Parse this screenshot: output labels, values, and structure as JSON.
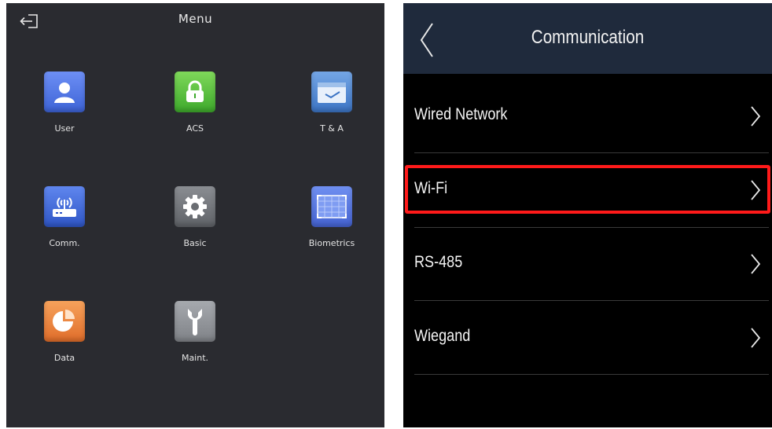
{
  "left_panel": {
    "title": "Menu",
    "back_icon": "logout-arrow-icon",
    "tiles": [
      {
        "label": "User",
        "icon": "user-icon",
        "color": "#4a6fe0"
      },
      {
        "label": "ACS",
        "icon": "lock-icon",
        "color": "#4cb83a"
      },
      {
        "label": "T & A",
        "icon": "time-attendance-icon",
        "color": "#4a82cf"
      },
      {
        "label": "Comm.",
        "icon": "router-icon",
        "color": "#3a62d4"
      },
      {
        "label": "Basic",
        "icon": "gear-icon",
        "color": "#6d7075"
      },
      {
        "label": "Biometrics",
        "icon": "biometrics-grid-icon",
        "color": "#5070de"
      },
      {
        "label": "Data",
        "icon": "pie-chart-icon",
        "color": "#ea7f3a"
      },
      {
        "label": "Maint.",
        "icon": "wrench-icon",
        "color": "#8d9095"
      }
    ]
  },
  "right_panel": {
    "title": "Communication",
    "back_icon": "chevron-left-icon",
    "items": [
      {
        "label": "Wired Network",
        "icon": "chevron-right-icon"
      },
      {
        "label": "Wi-Fi",
        "icon": "chevron-right-icon",
        "highlighted": true
      },
      {
        "label": "RS-485",
        "icon": "chevron-right-icon"
      },
      {
        "label": "Wiegand",
        "icon": "chevron-right-icon"
      }
    ],
    "highlight_color": "#ff1a1a"
  }
}
